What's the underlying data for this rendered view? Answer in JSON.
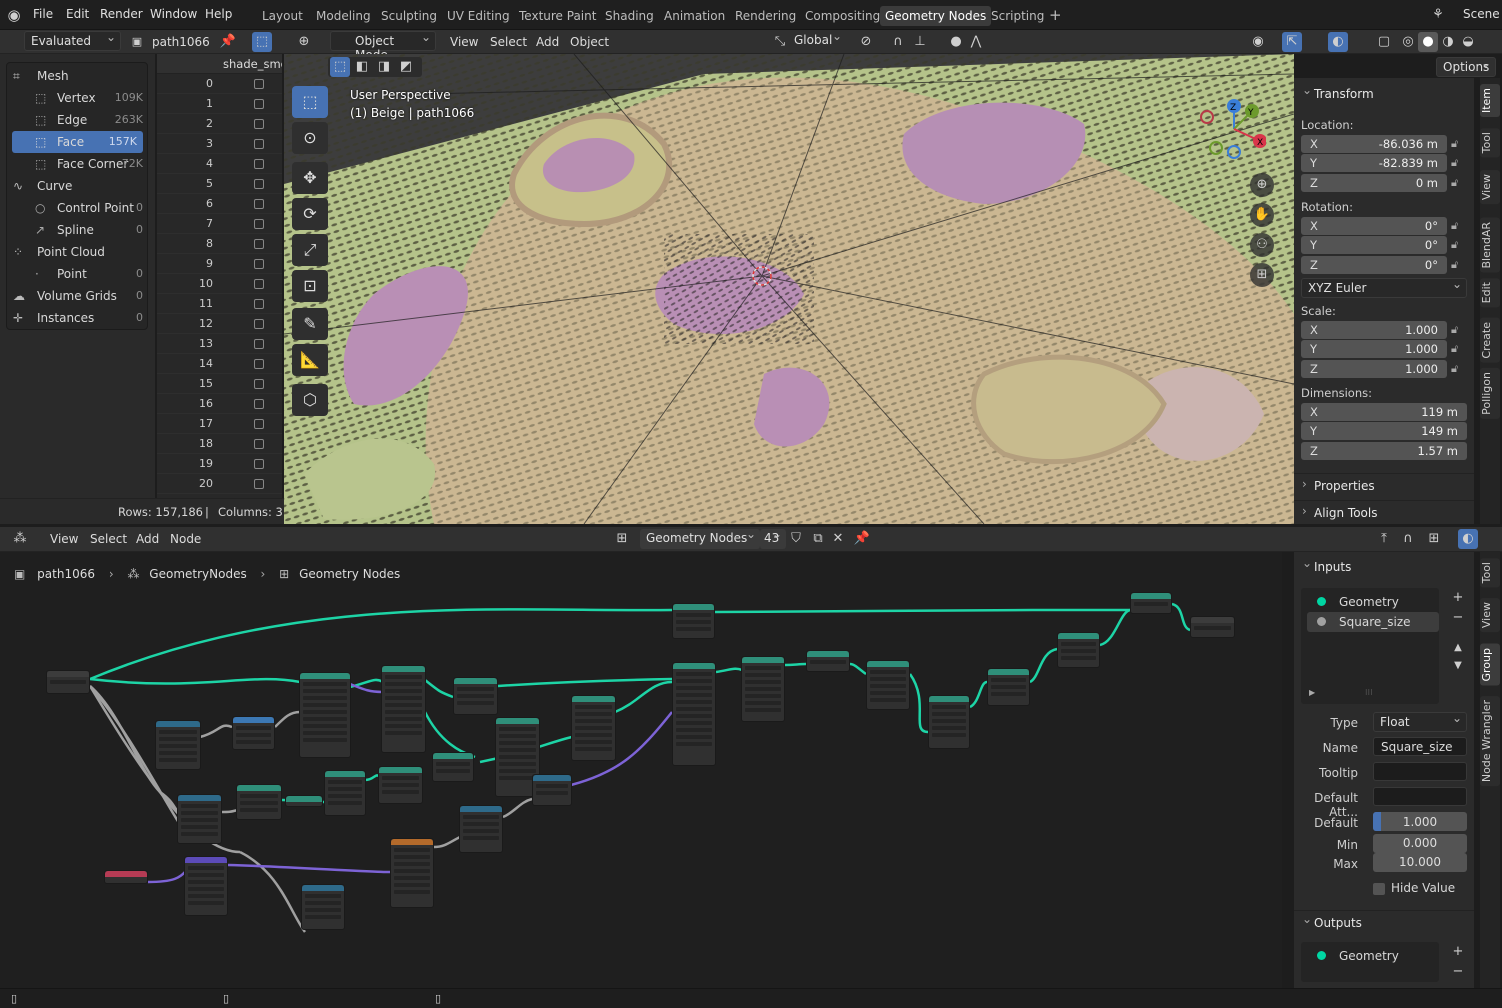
{
  "topbar": {
    "menus": [
      "File",
      "Edit",
      "Render",
      "Window",
      "Help"
    ],
    "workspaces": [
      "Layout",
      "Modeling",
      "Sculpting",
      "UV Editing",
      "Texture Paint",
      "Shading",
      "Animation",
      "Rendering",
      "Compositing",
      "Geometry Nodes",
      "Scripting"
    ],
    "active_workspace": "Geometry Nodes",
    "add_workspace": "+",
    "scene": "Scene"
  },
  "spreadsheet": {
    "mode": "Evaluated",
    "object": "path1066",
    "column_header": "shade_smoo",
    "outline": [
      {
        "label": "Mesh",
        "count": ""
      },
      {
        "label": "Vertex",
        "count": "109K"
      },
      {
        "label": "Edge",
        "count": "263K"
      },
      {
        "label": "Face",
        "count": "157K"
      },
      {
        "label": "Face Corner",
        "count": "72K"
      },
      {
        "label": "Curve",
        "count": ""
      },
      {
        "label": "Control Point",
        "count": "0"
      },
      {
        "label": "Spline",
        "count": "0"
      },
      {
        "label": "Point Cloud",
        "count": ""
      },
      {
        "label": "Point",
        "count": "0"
      },
      {
        "label": "Volume Grids",
        "count": "0"
      },
      {
        "label": "Instances",
        "count": "0"
      }
    ],
    "rows": [
      "0",
      "1",
      "2",
      "3",
      "4",
      "5",
      "6",
      "7",
      "8",
      "9",
      "10",
      "11",
      "12",
      "13",
      "14",
      "15",
      "16",
      "17",
      "18",
      "19",
      "20"
    ],
    "footer_rows": "Rows: 157,186",
    "footer_sep": "|",
    "footer_cols": "Columns: 3"
  },
  "viewport": {
    "mode": "Object Mode",
    "menus": [
      "View",
      "Select",
      "Add",
      "Object"
    ],
    "orientation": "Global",
    "options": "Options",
    "overlay_title": "User Perspective",
    "overlay_object": "(1) Beige | path1066"
  },
  "npanel": {
    "transform": "Transform",
    "location_label": "Location:",
    "location": [
      {
        "axis": "X",
        "value": "-86.036 m"
      },
      {
        "axis": "Y",
        "value": "-82.839 m"
      },
      {
        "axis": "Z",
        "value": "0 m"
      }
    ],
    "rotation_label": "Rotation:",
    "rotation": [
      {
        "axis": "X",
        "value": "0°"
      },
      {
        "axis": "Y",
        "value": "0°"
      },
      {
        "axis": "Z",
        "value": "0°"
      }
    ],
    "rotation_mode": "XYZ Euler",
    "scale_label": "Scale:",
    "scale": [
      {
        "axis": "X",
        "value": "1.000"
      },
      {
        "axis": "Y",
        "value": "1.000"
      },
      {
        "axis": "Z",
        "value": "1.000"
      }
    ],
    "dimensions_label": "Dimensions:",
    "dimensions": [
      {
        "axis": "X",
        "value": "119 m"
      },
      {
        "axis": "Y",
        "value": "149 m"
      },
      {
        "axis": "Z",
        "value": "1.57 m"
      }
    ],
    "properties": "Properties",
    "align_tools": "Align Tools",
    "tabs": [
      "Item",
      "Tool",
      "View",
      "BlendAR",
      "Edit",
      "Create",
      "Polligon"
    ]
  },
  "node_editor": {
    "menus": [
      "View",
      "Select",
      "Add",
      "Node"
    ],
    "tree_name": "Geometry Nodes",
    "users": "43",
    "breadcrumb": [
      "path1066",
      "GeometryNodes",
      "Geometry Nodes"
    ],
    "inputs_header": "Inputs",
    "inputs": [
      {
        "name": "Geometry",
        "color": "#00d6a3"
      },
      {
        "name": "Square_size",
        "color": "#a1a1a1"
      }
    ],
    "type_label": "Type",
    "type_value": "Float",
    "name_label": "Name",
    "name_value": "Square_size",
    "tooltip_label": "Tooltip",
    "default_att_label": "Default Att...",
    "default_label": "Default",
    "default_value": "1.000",
    "min_label": "Min",
    "min_value": "0.000",
    "max_label": "Max",
    "max_value": "10.000",
    "hide_value": "Hide Value",
    "outputs_header": "Outputs",
    "outputs": [
      {
        "name": "Geometry",
        "color": "#00d6a3"
      }
    ],
    "tabs": [
      "Tool",
      "View",
      "Group",
      "Node Wrangler"
    ]
  }
}
